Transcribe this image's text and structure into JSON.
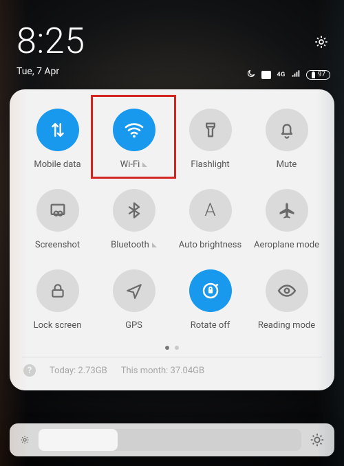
{
  "status": {
    "time": "8:25",
    "date": "Tue, 7 Apr",
    "network_label": "4G",
    "battery_pct": "97"
  },
  "tiles": {
    "t0": {
      "label": "Mobile data"
    },
    "t1": {
      "label": "Wi-Fi"
    },
    "t2": {
      "label": "Flashlight"
    },
    "t3": {
      "label": "Mute"
    },
    "t4": {
      "label": "Screenshot"
    },
    "t5": {
      "label": "Bluetooth"
    },
    "t6": {
      "label": "Auto brightness"
    },
    "t7": {
      "label": "Aeroplane mode"
    },
    "t8": {
      "label": "Lock screen"
    },
    "t9": {
      "label": "GPS"
    },
    "t10": {
      "label": "Rotate off"
    },
    "t11": {
      "label": "Reading mode"
    }
  },
  "usage": {
    "today_label": "Today:",
    "today_value": "2.73GB",
    "month_label": "This month:",
    "month_value": "37.04GB"
  }
}
